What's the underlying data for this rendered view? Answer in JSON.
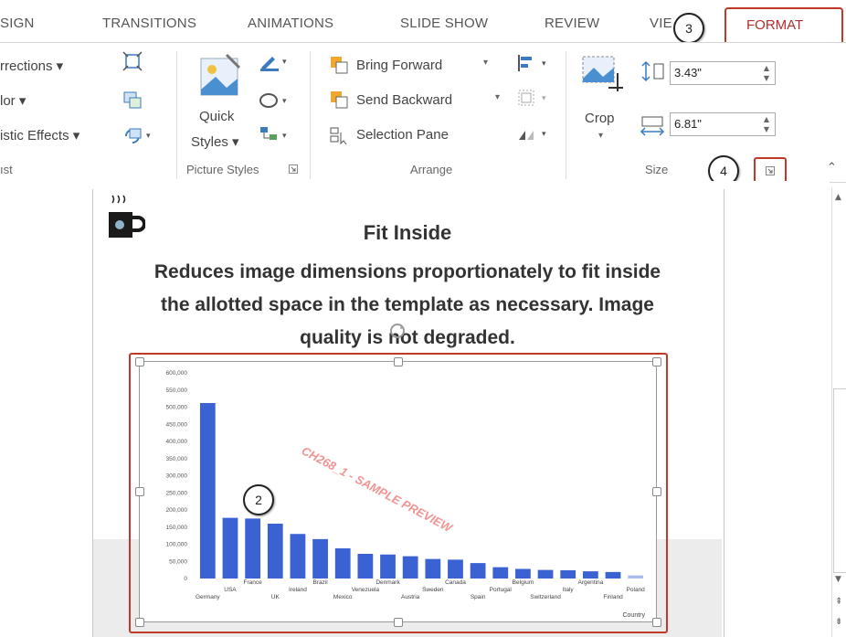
{
  "tabs": [
    "SIGN",
    "TRANSITIONS",
    "ANIMATIONS",
    "SLIDE SHOW",
    "REVIEW",
    "VIE",
    "FORMAT"
  ],
  "callouts": {
    "c3": "3",
    "c4": "4",
    "c2": "2"
  },
  "ribbon": {
    "adjust": {
      "corrections": "rrections ▾",
      "color": "lor ▾",
      "artistic": "istic Effects ▾",
      "title": "ıst"
    },
    "picture_styles": {
      "quick": "Quick",
      "styles": "Styles ▾",
      "title": "Picture Styles"
    },
    "arrange": {
      "bring_forward": "Bring Forward",
      "send_backward": "Send Backward",
      "selection_pane": "Selection Pane",
      "title": "Arrange"
    },
    "size": {
      "crop": "Crop",
      "height": "3.43\"",
      "width": "6.81\"",
      "title": "Size"
    }
  },
  "slide": {
    "title": "Fit Inside",
    "body_line1": "Reduces image dimensions proportionately to fit inside",
    "body_line2": "the allotted space in the template as necessary. Image",
    "body_line3": "quality is not degraded."
  },
  "chart_data": {
    "type": "bar",
    "title": "",
    "xlabel": "Country",
    "ylabel": "",
    "ylim": [
      0,
      600000
    ],
    "y_ticks": [
      "600,000",
      "550,000",
      "500,000",
      "450,000",
      "400,000",
      "350,000",
      "300,000",
      "250,000",
      "200,000",
      "150,000",
      "100,000",
      "50,000",
      "0"
    ],
    "categories": [
      "Germany",
      "USA",
      "France",
      "UK",
      "Ireland",
      "Brazil",
      "Mexico",
      "Venezuela",
      "Denmark",
      "Austria",
      "Sweden",
      "Canada",
      "Spain",
      "Portugal",
      "Belgium",
      "Switzerland",
      "Italy",
      "Argentina",
      "Finland",
      "Poland"
    ],
    "values": [
      512000,
      177000,
      175000,
      160000,
      130000,
      115000,
      88000,
      72000,
      70000,
      65000,
      57000,
      55000,
      45000,
      33000,
      28000,
      25000,
      24000,
      21000,
      19000,
      9000
    ],
    "watermark": "CH268_1 - SAMPLE PREVIEW",
    "bar_color": "#3a62d2"
  }
}
